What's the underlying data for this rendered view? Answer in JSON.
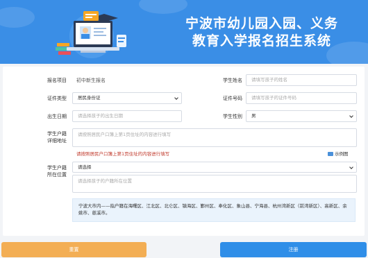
{
  "header": {
    "title_line1": "宁波市幼儿园入园、义务",
    "title_line2": "教育入学报名招生系统"
  },
  "form": {
    "project_label": "报名项目",
    "project_value": "初中新生报名",
    "student_name_label": "学生姓名",
    "student_name_placeholder": "请填写孩子的姓名",
    "id_type_label": "证件类型",
    "id_type_value": "居民身份证",
    "id_number_label": "证件号码",
    "id_number_placeholder": "请填写孩子的证件号码",
    "birth_label": "出生日期",
    "birth_placeholder": "请选择孩子的出生日期",
    "gender_label": "学生性别",
    "gender_value": "男",
    "address_label_1": "学生户籍",
    "address_label_2": "详细地址",
    "address_placeholder": "请按照居民户口簿上第1页住址的内容进行填写",
    "address_hint": "请按照居民户口簿上第1页住址的内容进行填写",
    "example_label": "示例图",
    "location_label_1": "学生户籍",
    "location_label_2": "所在位置",
    "location_select_value": "请选择",
    "location_placeholder": "请选择孩子的户籍所在位置",
    "notice": "宁波大市内——指户籍在海曙区、江北区、北仑区、镇海区、鄞州区、奉化区、象山县、宁海县、杭州湾新区（前湾新区）、高新区、余姚市、慈溪市。"
  },
  "buttons": {
    "reset": "重置",
    "submit": "注册"
  },
  "colors": {
    "banner": "#3a8ee6",
    "reset": "#f3ae54",
    "submit": "#2f8ee8",
    "hint": "#c0392b"
  }
}
